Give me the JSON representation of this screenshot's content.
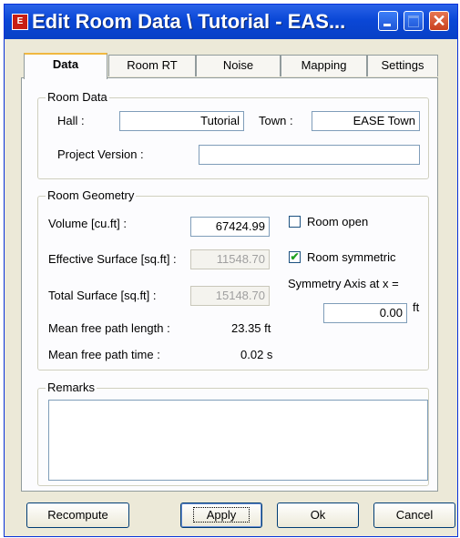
{
  "window": {
    "title": "Edit Room Data \\ Tutorial - EAS...",
    "icon": "ease-app-icon",
    "close_glyph": "✕"
  },
  "tabs": [
    {
      "label": "Data",
      "active": true
    },
    {
      "label": "Room RT",
      "active": false
    },
    {
      "label": "Noise",
      "active": false
    },
    {
      "label": "Mapping",
      "active": false
    },
    {
      "label": "Settings",
      "active": false
    }
  ],
  "room_data": {
    "group_label": "Room Data",
    "hall_label": "Hall :",
    "hall_value": "Tutorial",
    "town_label": "Town :",
    "town_value": "EASE Town",
    "project_version_label": "Project Version :",
    "project_version_value": ""
  },
  "room_geometry": {
    "group_label": "Room Geometry",
    "volume_label": "Volume [cu.ft] :",
    "volume_value": "67424.99",
    "effective_surface_label": "Effective Surface [sq.ft] :",
    "effective_surface_value": "11548.70",
    "total_surface_label": "Total Surface [sq.ft] :",
    "total_surface_value": "15148.70",
    "mean_free_path_length_label": "Mean free path length :",
    "mean_free_path_length_value": "23.35 ft",
    "mean_free_path_time_label": "Mean free path time :",
    "mean_free_path_time_value": "0.02 s",
    "room_open_label": "Room open",
    "room_open_checked": false,
    "room_symmetric_label": "Room symmetric",
    "room_symmetric_checked": true,
    "check_glyph": "✔",
    "symmetry_axis_label": "Symmetry Axis at x =",
    "symmetry_axis_value": "0.00",
    "symmetry_axis_unit": "ft"
  },
  "remarks": {
    "group_label": "Remarks",
    "value": ""
  },
  "buttons": {
    "recompute": "Recompute",
    "apply": "Apply",
    "ok": "Ok",
    "cancel": "Cancel"
  },
  "colors": {
    "titlebar": "#0a47d6",
    "dialog_bg": "#ece9d8",
    "active_tab_highlight": "#f0b840",
    "close_button": "#c8401e"
  }
}
